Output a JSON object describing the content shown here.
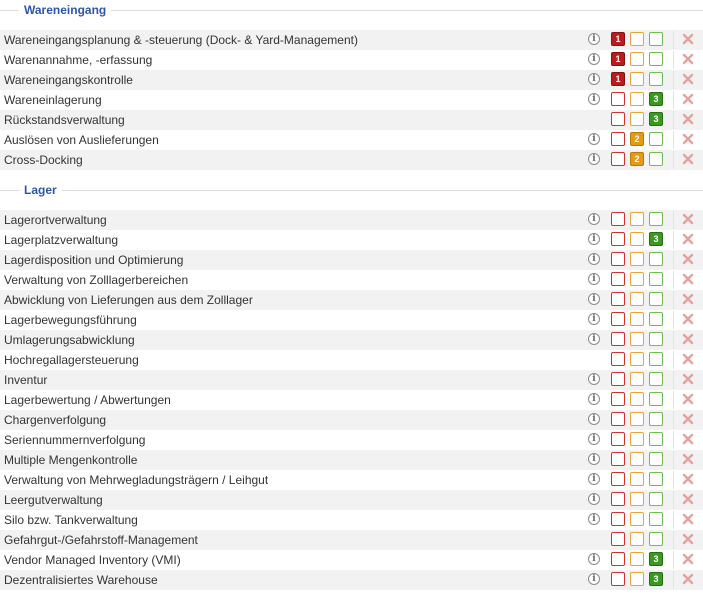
{
  "sections": [
    {
      "title": "Wareneingang",
      "rows": [
        {
          "label": "Wareneingangsplanung & -steuerung (Dock- & Yard-Management)",
          "info": true,
          "level": "1"
        },
        {
          "label": "Warenannahme, -erfassung",
          "info": true,
          "level": "1"
        },
        {
          "label": "Wareneingangskontrolle",
          "info": true,
          "level": "1"
        },
        {
          "label": "Wareneinlagerung",
          "info": true,
          "level": "3"
        },
        {
          "label": "Rückstandsverwaltung",
          "info": false,
          "level": "3"
        },
        {
          "label": "Auslösen von Auslieferungen",
          "info": true,
          "level": "2"
        },
        {
          "label": "Cross-Docking",
          "info": true,
          "level": "2"
        }
      ]
    },
    {
      "title": "Lager",
      "rows": [
        {
          "label": "Lagerortverwaltung",
          "info": true,
          "level": ""
        },
        {
          "label": "Lagerplatzverwaltung",
          "info": true,
          "level": "3"
        },
        {
          "label": "Lagerdisposition und Optimierung",
          "info": true,
          "level": ""
        },
        {
          "label": "Verwaltung von Zolllagerbereichen",
          "info": true,
          "level": ""
        },
        {
          "label": "Abwicklung von Lieferungen aus dem Zolllager",
          "info": true,
          "level": ""
        },
        {
          "label": "Lagerbewegungsführung",
          "info": true,
          "level": ""
        },
        {
          "label": "Umlagerungsabwicklung",
          "info": true,
          "level": ""
        },
        {
          "label": "Hochregallagersteuerung",
          "info": false,
          "level": ""
        },
        {
          "label": "Inventur",
          "info": true,
          "level": ""
        },
        {
          "label": "Lagerbewertung / Abwertungen",
          "info": true,
          "level": ""
        },
        {
          "label": "Chargenverfolgung",
          "info": true,
          "level": ""
        },
        {
          "label": "Seriennummernverfolgung",
          "info": true,
          "level": ""
        },
        {
          "label": "Multiple Mengenkontrolle",
          "info": true,
          "level": ""
        },
        {
          "label": "Verwaltung von Mehrwegladungsträgern / Leihgut",
          "info": true,
          "level": ""
        },
        {
          "label": "Leergutverwaltung",
          "info": true,
          "level": ""
        },
        {
          "label": "Silo bzw. Tankverwaltung",
          "info": true,
          "level": ""
        },
        {
          "label": "Gefahrgut-/Gefahrstoff-Management",
          "info": false,
          "level": ""
        },
        {
          "label": "Vendor Managed Inventory (VMI)",
          "info": true,
          "level": "3"
        },
        {
          "label": "Dezentralisiertes Warehouse",
          "info": true,
          "level": "3"
        }
      ]
    }
  ],
  "icons": {
    "info": "info-icon",
    "delete": "delete-x-icon"
  },
  "colors": {
    "legend": "#2d56a8",
    "level1": "#b81c1c",
    "level2": "#e39b17",
    "level3": "#3a9a1f",
    "delete": "#e8a0a0"
  }
}
